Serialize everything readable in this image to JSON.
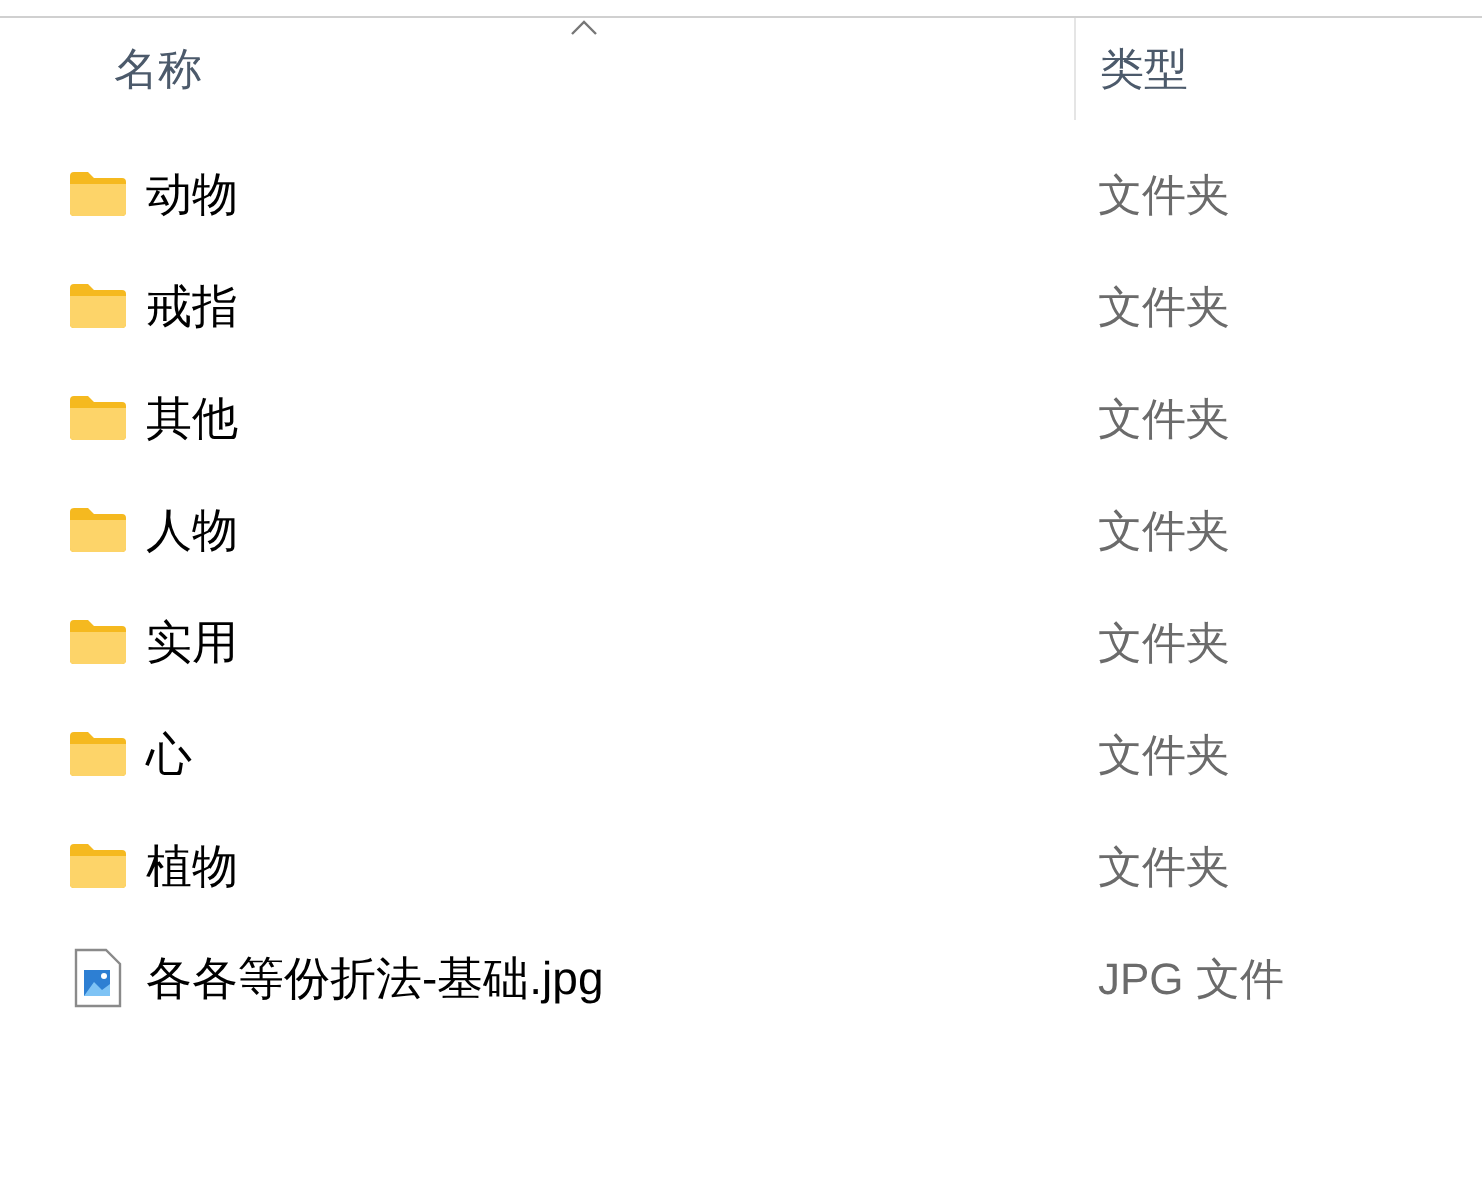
{
  "columns": [
    {
      "label": "名称",
      "sorted": true
    },
    {
      "label": "类型",
      "sorted": false
    }
  ],
  "rows": [
    {
      "kind": "folder",
      "name": "动物",
      "type": "文件夹"
    },
    {
      "kind": "folder",
      "name": "戒指",
      "type": "文件夹"
    },
    {
      "kind": "folder",
      "name": "其他",
      "type": "文件夹"
    },
    {
      "kind": "folder",
      "name": "人物",
      "type": "文件夹"
    },
    {
      "kind": "folder",
      "name": "实用",
      "type": "文件夹"
    },
    {
      "kind": "folder",
      "name": "心",
      "type": "文件夹"
    },
    {
      "kind": "folder",
      "name": "植物",
      "type": "文件夹"
    },
    {
      "kind": "image",
      "name": "各各等份折法-基础.jpg",
      "type": "JPG 文件"
    }
  ]
}
